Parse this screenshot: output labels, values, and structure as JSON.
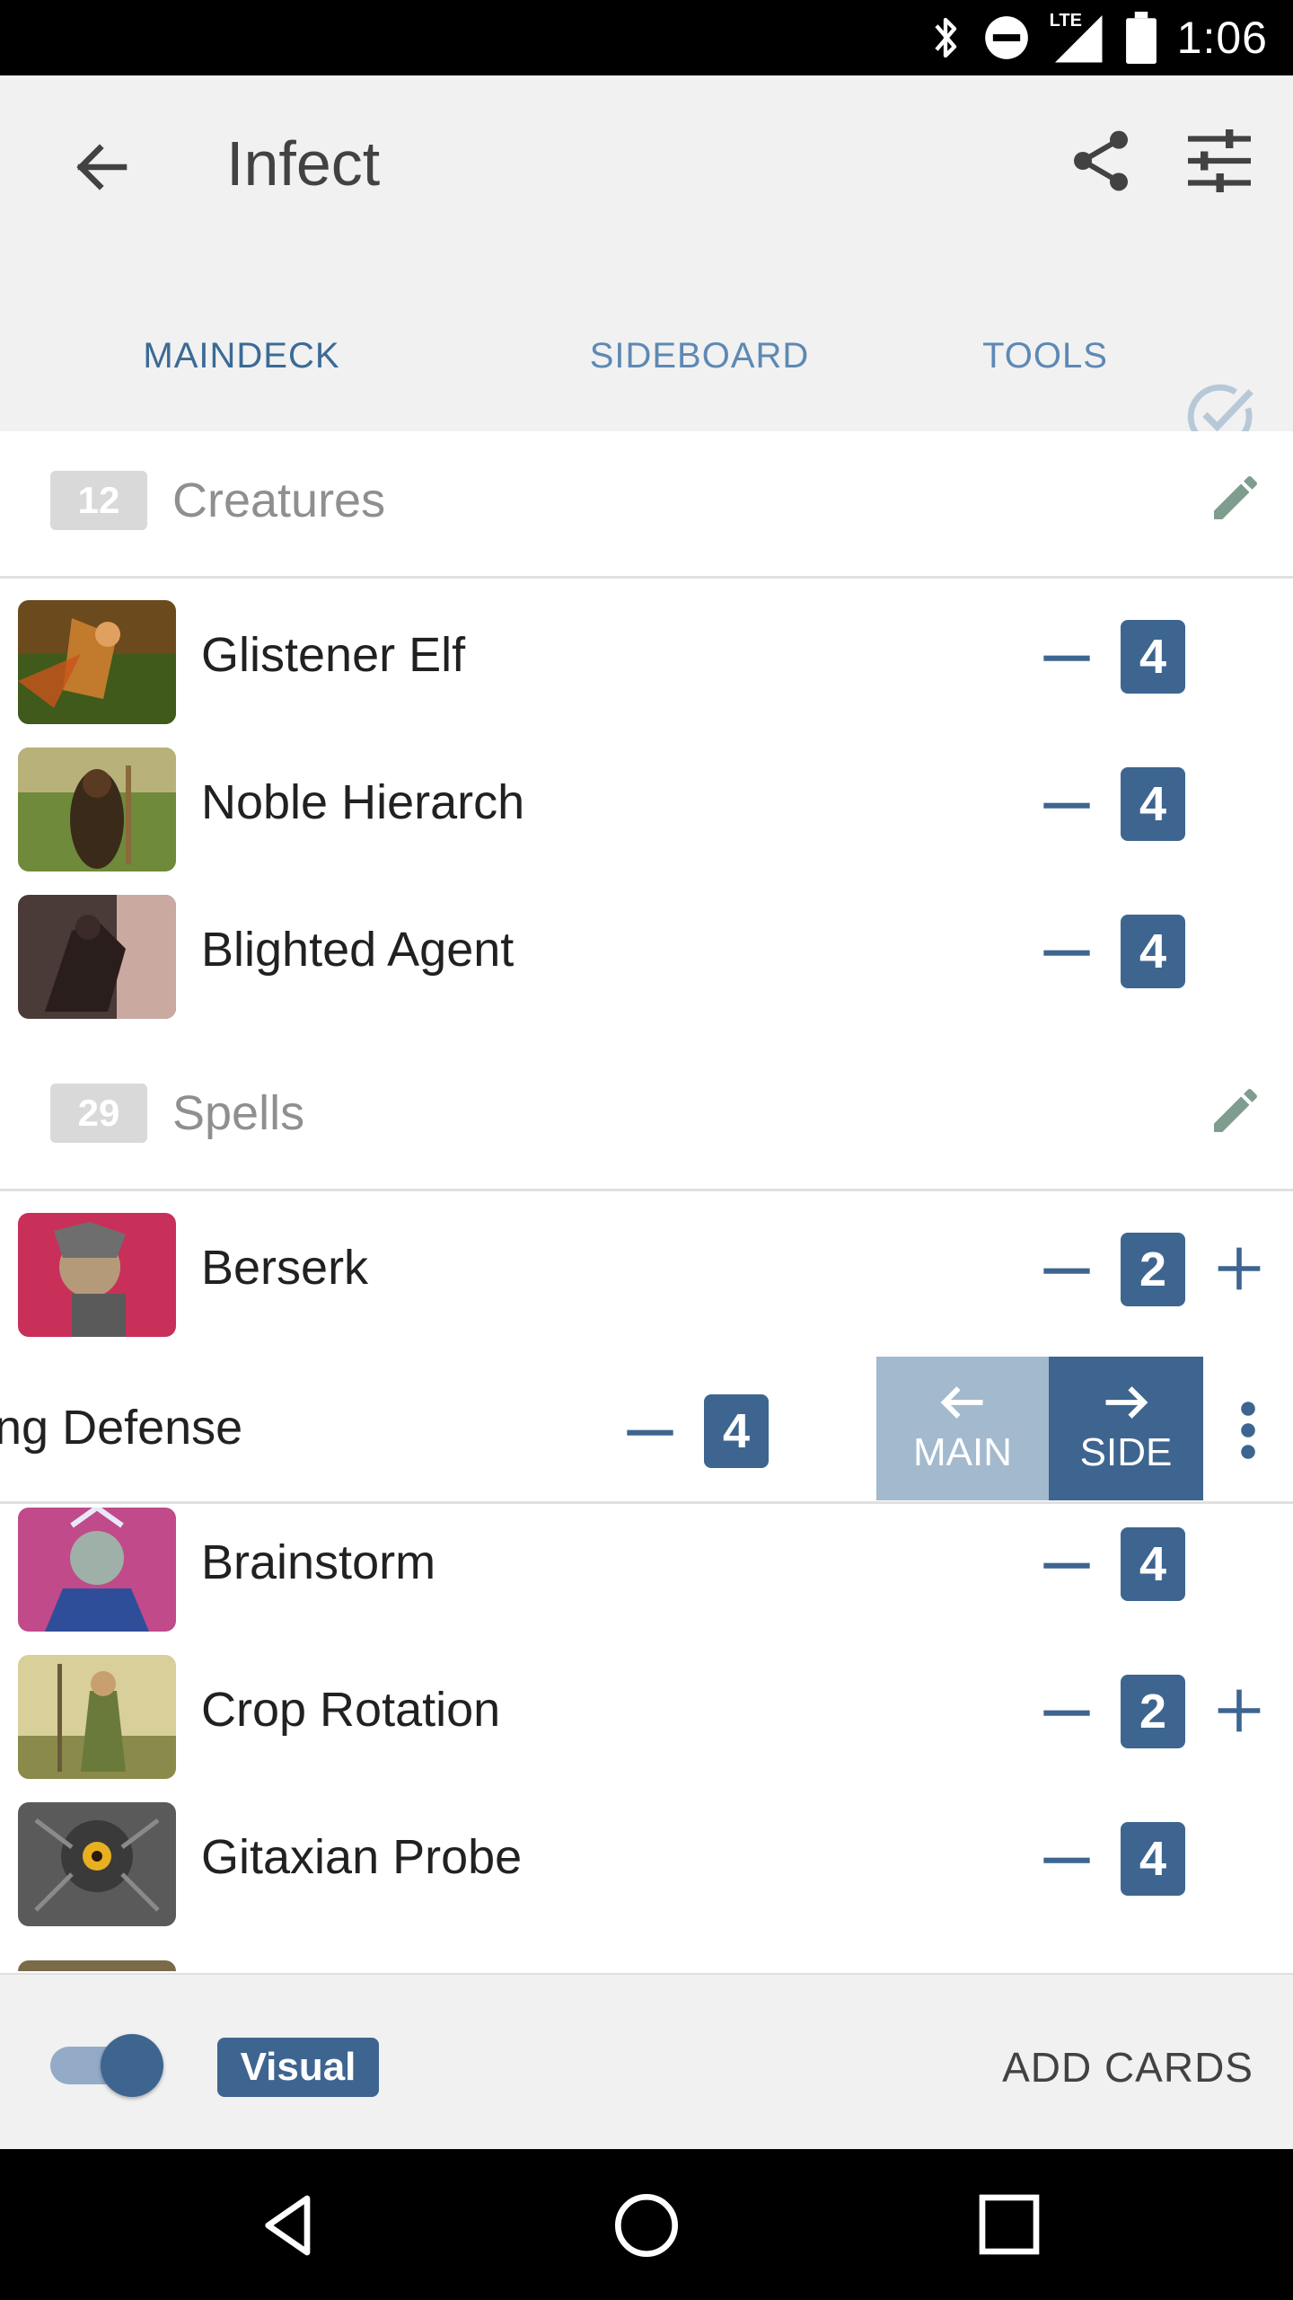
{
  "status_bar": {
    "time": "1:06",
    "network": "LTE"
  },
  "app_bar": {
    "title": "Infect"
  },
  "tabs": [
    {
      "label": "MAINDECK",
      "selected": true
    },
    {
      "label": "SIDEBOARD",
      "selected": false
    },
    {
      "label": "TOOLS",
      "selected": false
    }
  ],
  "sections": {
    "creatures": {
      "count": "12",
      "label": "Creatures"
    },
    "spells": {
      "count": "29",
      "label": "Spells"
    }
  },
  "creatures": [
    {
      "name": "Glistener Elf",
      "qty": "4"
    },
    {
      "name": "Noble Hierarch",
      "qty": "4"
    },
    {
      "name": "Blighted Agent",
      "qty": "4"
    }
  ],
  "spells": [
    {
      "name": "Berserk",
      "qty": "2"
    },
    {
      "name": "ng Defense",
      "qty": "4"
    },
    {
      "name": "Brainstorm",
      "qty": "4"
    },
    {
      "name": "Crop Rotation",
      "qty": "2"
    },
    {
      "name": "Gitaxian Probe",
      "qty": "4"
    }
  ],
  "swipe_actions": {
    "main_label": "MAIN",
    "side_label": "SIDE"
  },
  "bottom_bar": {
    "visual_label": "Visual",
    "add_cards_label": "ADD CARDS",
    "visual_toggle_on": true
  },
  "colors": {
    "accent": "#3d6590",
    "tab_active": "#3b6a96",
    "tab_inactive": "#5d89b4",
    "main_move": "#a3b9ce",
    "section_badge": "#d9d9d9"
  },
  "icons": {
    "back": "arrow-back-icon",
    "share": "share-icon",
    "tune": "tune-icon",
    "check": "check-circle-icon",
    "edit": "pencil-icon",
    "minus": "minus-icon",
    "plus": "plus-icon",
    "more": "more-vert-icon"
  }
}
